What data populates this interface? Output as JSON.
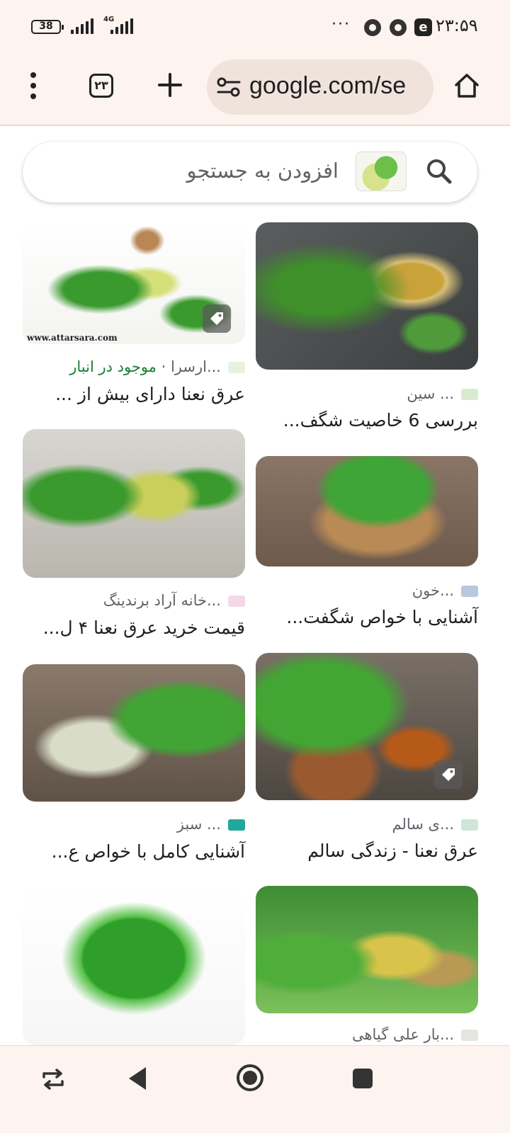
{
  "status_bar": {
    "battery": "38",
    "network": "4G",
    "time": "۲۳:۵۹",
    "more_dots": "···",
    "edge_glyph": "e"
  },
  "toolbar": {
    "tab_count": "۲۳",
    "url": "google.com/se"
  },
  "search": {
    "placeholder": "افزودن به جستجو"
  },
  "results": [
    {
      "source": "... سین",
      "title": "بررسی 6 خاصیت شگف..."
    },
    {
      "source": "...ارسرا",
      "stock": "موجود در انبار",
      "separator": "·",
      "title": "عرق نعنا دارای بیش از ..."
    },
    {
      "source": "...خون",
      "title": "آشنایی با خواص شگفت..."
    },
    {
      "source": "...خانه آراد برندینگ",
      "title": "قیمت خرید عرق نعنا ۴ ل..."
    },
    {
      "source": "...ی سالم",
      "title": "عرق نعنا - زندگی سالم"
    },
    {
      "source": "... سبز",
      "title": "آشنایی کامل با خواص ع..."
    },
    {
      "source": "...بار علی گیاهی",
      "title": ""
    },
    {
      "source": "",
      "title": ""
    }
  ],
  "watermarks": {
    "attarsara": "www.attarsara.com"
  },
  "colors": {
    "chrome_bg": "#fdf3ef",
    "url_bg": "#efe3dc",
    "in_stock": "#188038"
  }
}
